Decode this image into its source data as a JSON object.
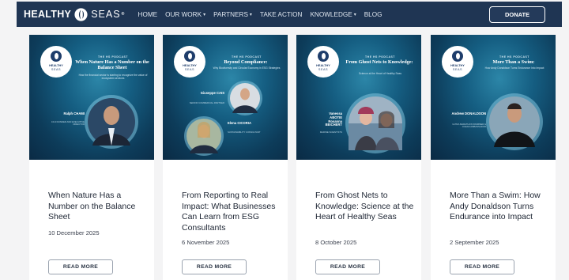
{
  "brand": {
    "name_bold": "HEALTHY",
    "name_light": "SEAS",
    "mark": "®"
  },
  "nav": [
    {
      "label": "HOME",
      "dropdown": false
    },
    {
      "label": "OUR WORK",
      "dropdown": true
    },
    {
      "label": "PARTNERS",
      "dropdown": true
    },
    {
      "label": "TAKE ACTION",
      "dropdown": false
    },
    {
      "label": "KNOWLEDGE",
      "dropdown": true
    },
    {
      "label": "BLOG",
      "dropdown": false
    }
  ],
  "donate_label": "DONATE",
  "podcast_label": "THE HS PODCAST",
  "logo_text": {
    "line1": "HEALTHY",
    "line2": "SEAS"
  },
  "cards": [
    {
      "image_title": "When Nature Has a Number on the Balance Sheet",
      "image_subtitle": "How the financial sector is starting to recognize the value of ecosystem services",
      "guests": [
        {
          "name": "Ralph CHAMI",
          "role": "CO-FOUNDER AND EXECUTIVE DIRECTOR"
        }
      ],
      "title": "When Nature Has a Number on the Balance Sheet",
      "date": "10 December 2025",
      "button": "READ MORE"
    },
    {
      "image_title": "Beyond Compliance:",
      "image_subtitle": "Why Biodiversity and Circular Economy in ESG Strategies",
      "guests": [
        {
          "name": "Giuseppe CAIS",
          "role": "SENIOR COMMERCIAL PARTNER"
        },
        {
          "name": "Elena CICORIA",
          "role": "SUSTAINABILITY CONSULTANT"
        }
      ],
      "title": "From Reporting to Real Impact: What Businesses Can Learn from ESG Consultants",
      "date": "6 November 2025",
      "button": "READ MORE"
    },
    {
      "image_title": "From Ghost Nets to Knowledge:",
      "image_subtitle": "Science at the Heart of Healthy Seas",
      "guests": [
        {
          "name": "Vanessa ABOTIE Rosanna BEICHERT",
          "role": "MARINE SCIENTISTS"
        }
      ],
      "title": "From Ghost Nets to Knowledge: Science at the Heart of Healthy Seas",
      "date": "8 October 2025",
      "button": "READ MORE"
    },
    {
      "image_title": "More Than a Swim:",
      "image_subtitle": "How Andy Donaldson Turns Endurance Into Impact",
      "guests": [
        {
          "name": "Andrew DONALDSON",
          "role": "ULTRA MARATHON SWIMMER & OCEAN AMBASSADOR"
        }
      ],
      "title": "More Than a Swim: How Andy Donaldson Turns Endurance into Impact",
      "date": "2 September 2025",
      "button": "READ MORE"
    }
  ]
}
